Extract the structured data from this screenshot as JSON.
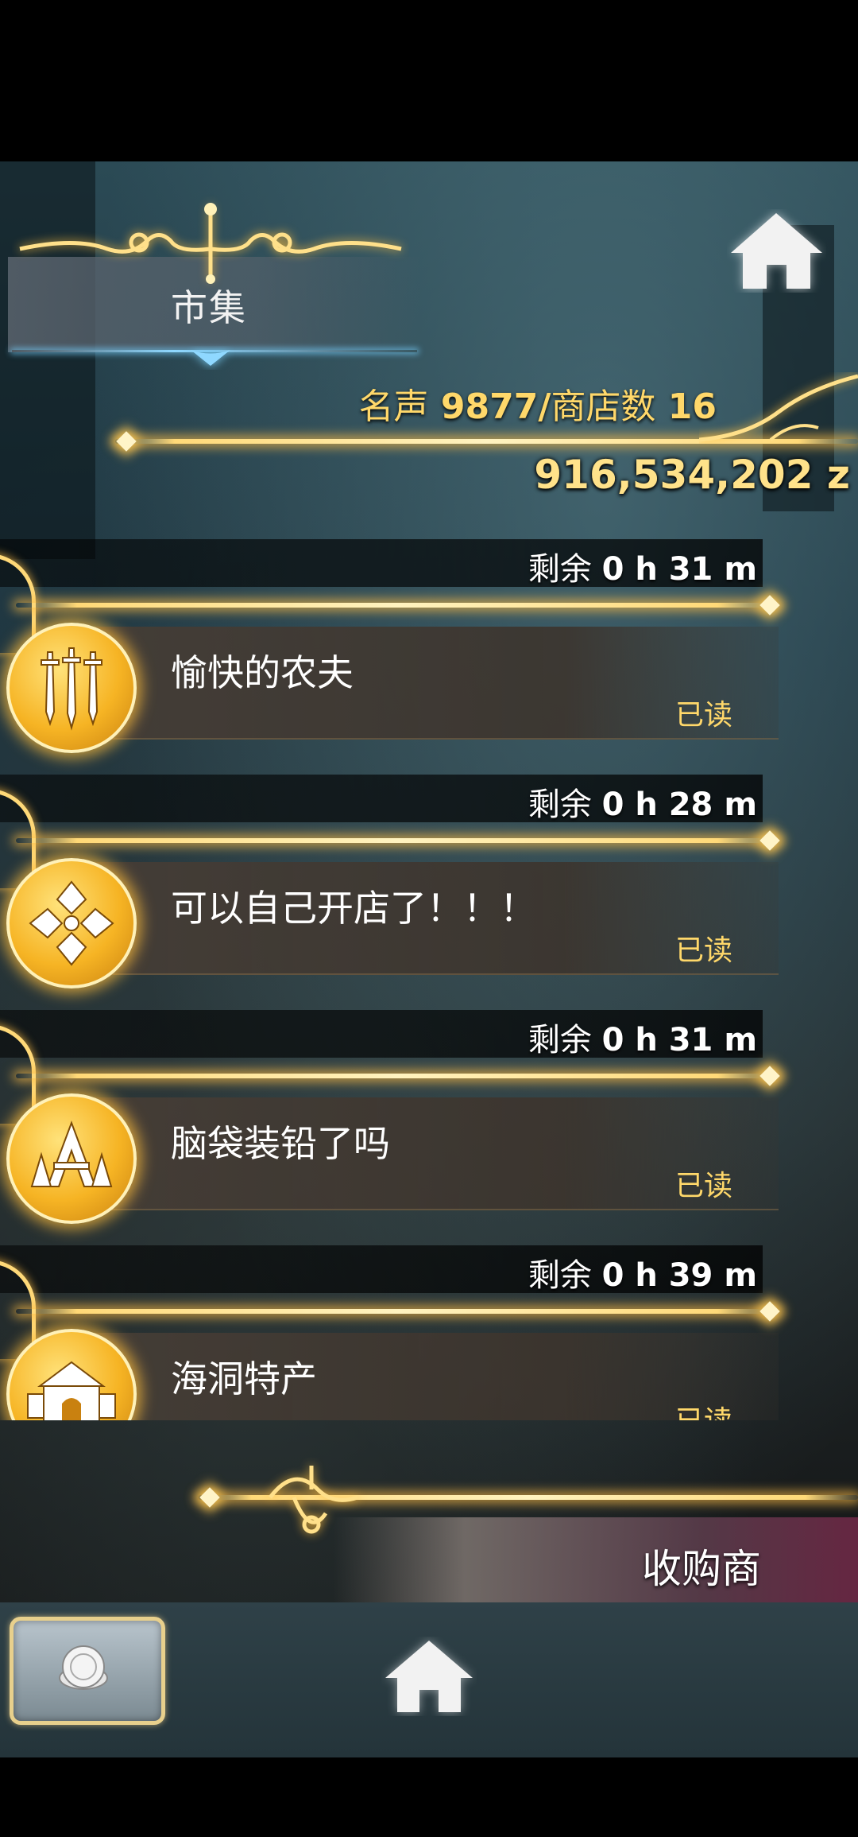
{
  "header": {
    "title": "市集",
    "fame_label": "名声",
    "fame_value": "9877",
    "separator": "/",
    "shop_count_label": "商店数",
    "shop_count_value": "16",
    "money": "916,534,202 z"
  },
  "shops": [
    {
      "timer_label": "剩余",
      "timer_value": "0 h 31 m",
      "name": "愉快的农夫",
      "status": "已读",
      "icon": "swords-icon"
    },
    {
      "timer_label": "剩余",
      "timer_value": "0 h 28 m",
      "name": "可以自己开店了！！！",
      "status": "已读",
      "icon": "cross-emblem-icon"
    },
    {
      "timer_label": "剩余",
      "timer_value": "0 h 31 m",
      "name": "脑袋装铅了吗",
      "status": "已读",
      "icon": "a-emblem-icon"
    },
    {
      "timer_label": "剩余",
      "timer_value": "0 h 39 m",
      "name": "海洞特产",
      "status": "已读",
      "icon": "castle-gate-icon"
    }
  ],
  "bottom": {
    "buyer_label": "收购商"
  },
  "colors": {
    "gold": "#ffd86a",
    "gold_glow": "#ffd978",
    "card_bg": "#463e37",
    "emblem": "#f6b424"
  }
}
